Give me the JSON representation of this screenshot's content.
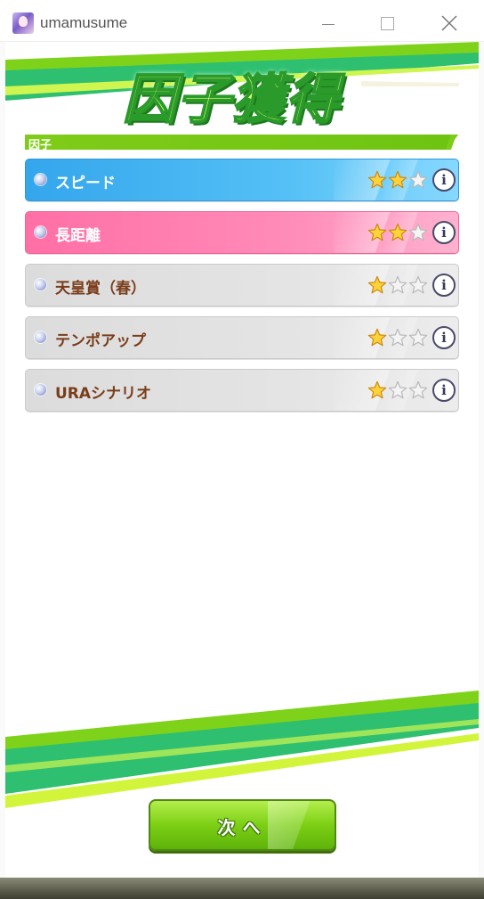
{
  "window": {
    "title": "umamusume"
  },
  "header": {
    "title": "因子獲得"
  },
  "section": {
    "label": "因子"
  },
  "factors": [
    {
      "name": "スピード",
      "stars": 2,
      "max_stars": 3,
      "color": "#4ab5f2",
      "style": "blue"
    },
    {
      "name": "長距離",
      "stars": 2,
      "max_stars": 3,
      "color": "#ff7eb0",
      "style": "pink"
    },
    {
      "name": "天皇賞（春）",
      "stars": 1,
      "max_stars": 3,
      "color": "#e0e0e0",
      "style": "gray"
    },
    {
      "name": "テンポアップ",
      "stars": 1,
      "max_stars": 3,
      "color": "#e0e0e0",
      "style": "gray"
    },
    {
      "name": "URAシナリオ",
      "stars": 1,
      "max_stars": 3,
      "color": "#e0e0e0",
      "style": "gray"
    }
  ],
  "info_icon_label": "i",
  "next_button": {
    "label": "次へ"
  },
  "colors": {
    "accent_green": "#7fcc18",
    "gray_text": "#7a3d1a"
  }
}
